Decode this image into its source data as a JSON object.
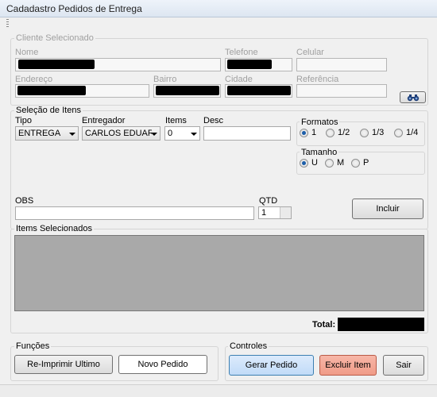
{
  "window": {
    "title": "Cadadastro Pedidos  de Entrega"
  },
  "cliente": {
    "legend": "Cliente Selecionado",
    "nome_label": "Nome",
    "telefone_label": "Telefone",
    "celular_label": "Celular",
    "endereco_label": "Endereço",
    "bairro_label": "Bairro",
    "cidade_label": "Cidade",
    "referencia_label": "Referência",
    "search_icon": "binoculars-icon"
  },
  "itens": {
    "legend": "Seleção de Itens",
    "tipo_label": "Tipo",
    "tipo_value": "ENTREGA",
    "entregador_label": "Entregador",
    "entregador_value": "CARLOS EDUARDO",
    "items_label": "Items",
    "items_value": "0",
    "desc_label": "Desc",
    "formatos_legend": "Formatos",
    "formatos": [
      "1",
      "1/2",
      "1/3",
      "1/4"
    ],
    "formato_selected": "1",
    "tamanho_legend": "Tamanho",
    "tamanhos": [
      "U",
      "M",
      "P"
    ],
    "tamanho_selected": "U",
    "obs_label": "OBS",
    "qtd_label": "QTD",
    "qtd_value": "1",
    "incluir_label": "Incluir"
  },
  "selecionados": {
    "legend": "Items Selecionados",
    "total_label": "Total:"
  },
  "funcoes": {
    "legend": "Funções",
    "reimprimir_label": "Re-Imprimir Ultimo",
    "novo_label": "Novo Pedido"
  },
  "controles": {
    "legend": "Controles",
    "gerar_label": "Gerar Pedido",
    "excluir_label": "Excluir Item",
    "sair_label": "Sair"
  },
  "colors": {
    "list_bg": "#a9a9a9",
    "gerar_bg": "#c9e0f9",
    "excluir_bg": "#f2a591",
    "redaction": "#000000"
  }
}
